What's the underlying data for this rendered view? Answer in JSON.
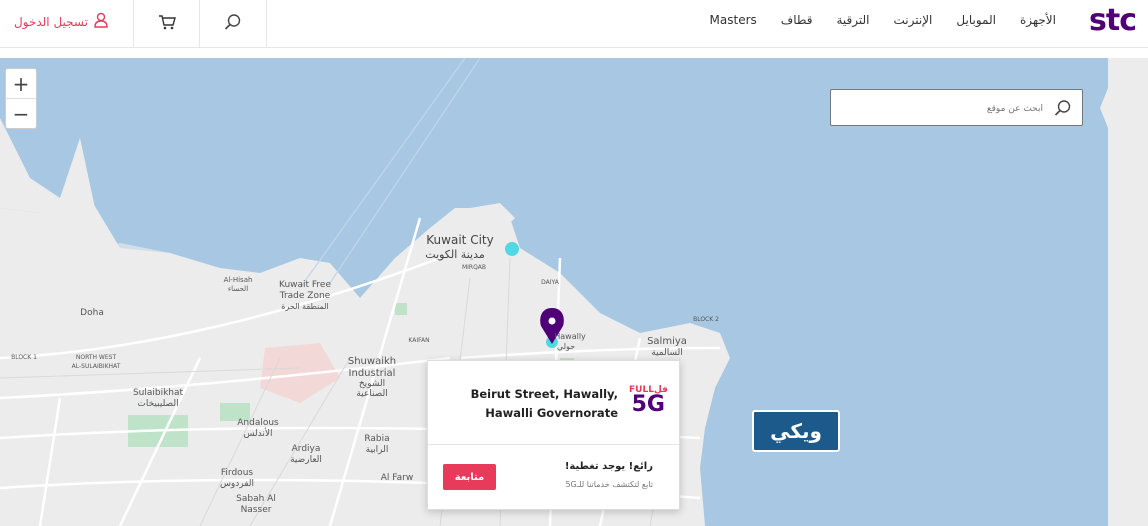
{
  "header": {
    "login_label": "تسجيل الدخول",
    "nav": [
      "الأجهزة",
      "الموبايل",
      "الإنترنت",
      "الترقية",
      "قطاف",
      "Masters"
    ],
    "logo_text": "stc"
  },
  "map": {
    "search_placeholder": "ابحث عن موقع",
    "zoom_in": "+",
    "zoom_out": "−",
    "labels": {
      "kuwait_city": "Kuwait City",
      "kuwait_city_ar": "مدينة الكويت",
      "free_trade": "Kuwait Free",
      "free_trade2": "Trade Zone",
      "free_trade_ar": "المنطقة الحرة",
      "doha": "Doha",
      "shuwaikh": "Shuwaikh",
      "industrial": "Industrial",
      "shuwaikh_ar": "الشويخ",
      "shuwaikh_ar2": "الصناعية",
      "salmiya": "Salmiya",
      "salmiya_ar": "السالمية",
      "sulaibikhat": "Sulaibikhat",
      "sulaibikhat_ar": "الصليبيخات",
      "andalous": "Andalous",
      "andalous_ar": "الأندلس",
      "ardiya": "Ardiya",
      "ardiya_ar": "العارضية",
      "rabia": "Rabia",
      "rabia_ar": "الرابية",
      "firdous": "Firdous",
      "firdous_ar": "الفردوس",
      "sabah": "Sabah Al",
      "sabah2": "Nasser",
      "alhisah": "Al-Hisah",
      "alhisah_ar": "الحساء",
      "mirqab": "MIRQAB",
      "daiya": "DAIYA",
      "kaifan": "KAIFAN",
      "farwaniya": "Al Farw",
      "block1": "BLOCK 1",
      "block2": "BLOCK 2",
      "north_west": "NORTH WEST",
      "sulaibikhat_up": "AL-SULAIBIKHAT",
      "hawally": "Hawally",
      "hawally_ar": "حولي"
    },
    "popup": {
      "address": "Beirut Street, Hawally, Hawalli Governorate",
      "badge_full": "FULLفل",
      "badge_5g": "5G",
      "coverage_title": "رائع! يوجد تغطية!",
      "coverage_sub": "تابع لتكتشف خدماتنا للـ5G",
      "follow_label": "متابعة"
    },
    "wiki_label": "ويكي",
    "colors": {
      "water": "#a8c7e2",
      "land": "#ececec",
      "accent": "#4f0077",
      "pink": "#e83a5a"
    }
  }
}
